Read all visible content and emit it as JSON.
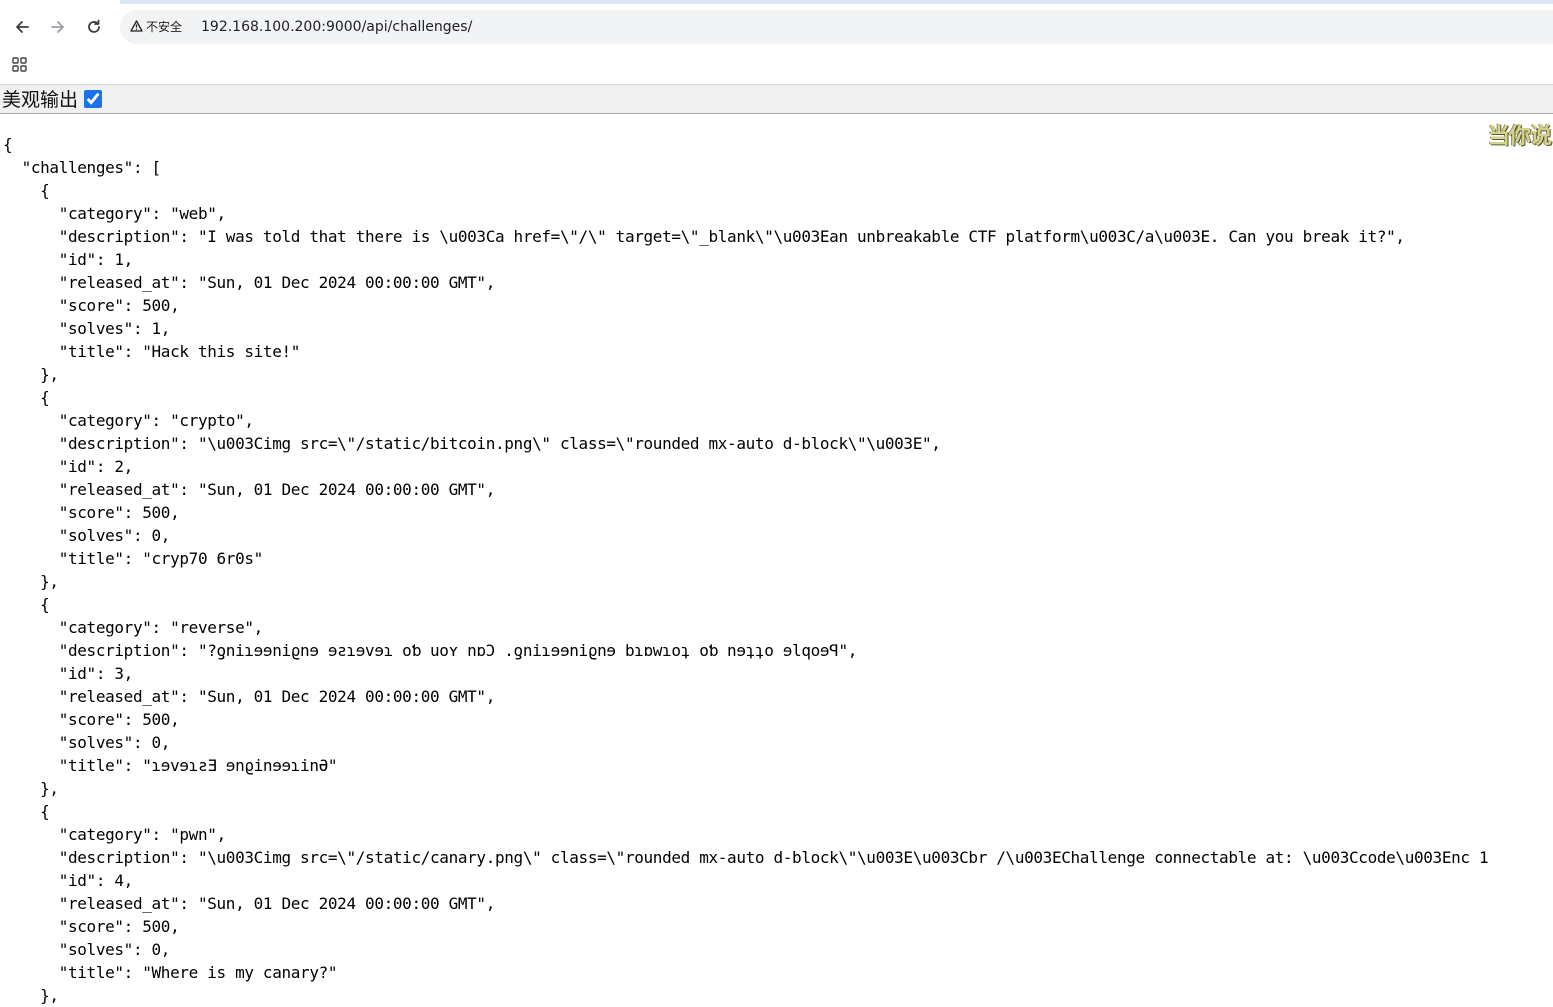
{
  "browser": {
    "back_icon": "arrow-left-icon",
    "forward_icon": "arrow-right-icon",
    "reload_icon": "reload-icon",
    "security_icon": "warning-triangle-icon",
    "security_label": "不安全",
    "url": "192.168.100.200:9000/api/challenges/"
  },
  "bookmarks": {
    "apps_icon": "apps-grid-icon"
  },
  "toolbar": {
    "pretty_label": "美观输出",
    "pretty_checked": true
  },
  "extension": {
    "badge_text": "当你说"
  },
  "json_lines": [
    "{",
    "  \"challenges\": [",
    "    {",
    "      \"category\": \"web\",",
    "      \"description\": \"I was told that there is \\u003Ca href=\\\"/\\\" target=\\\"_blank\\\"\\u003Ean unbreakable CTF platform\\u003C/a\\u003E. Can you break it?\",",
    "      \"id\": 1,",
    "      \"released_at\": \"Sun, 01 Dec 2024 00:00:00 GMT\",",
    "      \"score\": 500,",
    "      \"solves\": 1,",
    "      \"title\": \"Hack this site!\"",
    "    },",
    "    {",
    "      \"category\": \"crypto\",",
    "      \"description\": \"\\u003Cimg src=\\\"/static/bitcoin.png\\\" class=\\\"rounded mx-auto d-block\\\"\\u003E\",",
    "      \"id\": 2,",
    "      \"released_at\": \"Sun, 01 Dec 2024 00:00:00 GMT\",",
    "      \"score\": 500,",
    "      \"solves\": 0,",
    "      \"title\": \"cryp70 6r0s\"",
    "    },",
    "    {",
    "      \"category\": \"reverse\",",
    "      \"description\": \"?ƍniɿɘɘniϱnɘ ɘƨɿɘvɘɿ oƅ uoʏ nɒϽ .ƍniɿɘɘniϱnɘ bɿɒwɿoʇ oƅ nɘʇʇo ɘlqoɘꟼ\",",
    "      \"id\": 3,",
    "      \"released_at\": \"Sun, 01 Dec 2024 00:00:00 GMT\",",
    "      \"score\": 500,",
    "      \"solves\": 0,",
    "      \"title\": \"ɿɘvɘɿƨƎ ɘnϱinɘɘɿinƏ\"",
    "    },",
    "    {",
    "      \"category\": \"pwn\",",
    "      \"description\": \"\\u003Cimg src=\\\"/static/canary.png\\\" class=\\\"rounded mx-auto d-block\\\"\\u003E\\u003Cbr /\\u003EChallenge connectable at: \\u003Ccode\\u003Enc 1",
    "      \"id\": 4,",
    "      \"released_at\": \"Sun, 01 Dec 2024 00:00:00 GMT\",",
    "      \"score\": 500,",
    "      \"solves\": 0,",
    "      \"title\": \"Where is my canary?\"",
    "    },"
  ]
}
